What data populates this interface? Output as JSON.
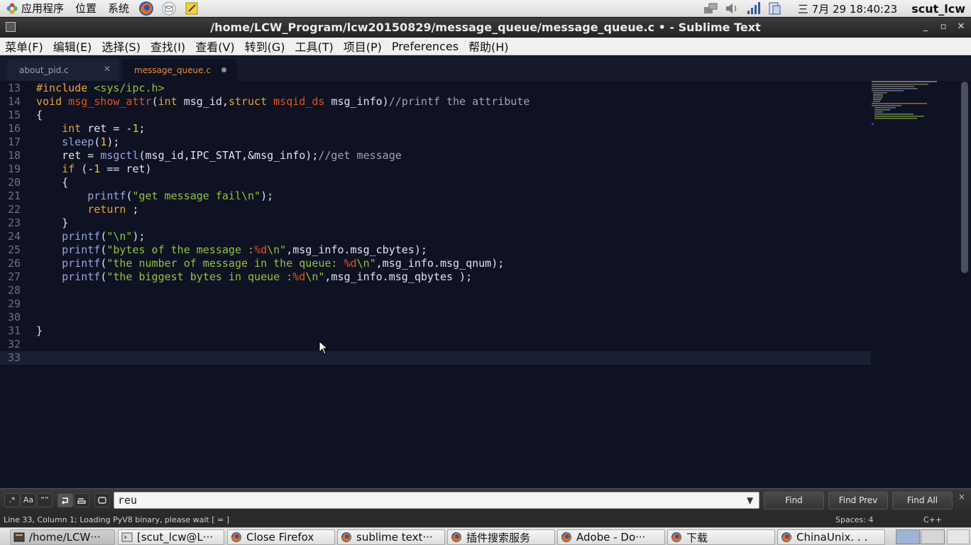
{
  "top_panel": {
    "menus": [
      "应用程序",
      "位置",
      "系统"
    ],
    "clock": "三 7月 29 18:40:23",
    "user": "scut_lcw"
  },
  "window": {
    "title": "/home/LCW_Program/lcw20150829/message_queue/message_queue.c • - Sublime Text"
  },
  "menubar": [
    "菜单(F)",
    "编辑(E)",
    "选择(S)",
    "查找(I)",
    "查看(V)",
    "转到(G)",
    "工具(T)",
    "项目(P)",
    "Preferences",
    "帮助(H)"
  ],
  "tabs": [
    {
      "label": "about_pid.c",
      "state": "saved"
    },
    {
      "label": "message_queue.c",
      "state": "modified"
    }
  ],
  "editor": {
    "current_line": 33,
    "lines": [
      {
        "n": "13",
        "text": "#include <sys/ipc.h>"
      },
      {
        "n": "14",
        "text": "void msg_show_attr(int msg_id,struct msqid_ds msg_info)//printf the attribute"
      },
      {
        "n": "15",
        "text": "{"
      },
      {
        "n": "16",
        "text": "    int ret = -1;"
      },
      {
        "n": "17",
        "text": "    sleep(1);"
      },
      {
        "n": "18",
        "text": "    ret = msgctl(msg_id,IPC_STAT,&msg_info);//get message"
      },
      {
        "n": "19",
        "text": "    if (-1 == ret)"
      },
      {
        "n": "20",
        "text": "    {"
      },
      {
        "n": "21",
        "text": "        printf(\"get message fail\\n\");"
      },
      {
        "n": "22",
        "text": "        return ;"
      },
      {
        "n": "23",
        "text": "    }"
      },
      {
        "n": "24",
        "text": "    printf(\"\\n\");"
      },
      {
        "n": "25",
        "text": "    printf(\"bytes of the message :%d\\n\",msg_info.msg_cbytes);"
      },
      {
        "n": "26",
        "text": "    printf(\"the number of message in the queue: %d\\n\",msg_info.msg_qnum);"
      },
      {
        "n": "27",
        "text": "    printf(\"the biggest bytes in queue :%d\\n\",msg_info.msg_qbytes );"
      },
      {
        "n": "28",
        "text": ""
      },
      {
        "n": "29",
        "text": ""
      },
      {
        "n": "30",
        "text": ""
      },
      {
        "n": "31",
        "text": "}"
      },
      {
        "n": "32",
        "text": ""
      },
      {
        "n": "33",
        "text": ""
      }
    ]
  },
  "find_panel": {
    "options": [
      ".*",
      "Aa",
      "“”"
    ],
    "query": "reu",
    "buttons": {
      "find": "Find",
      "find_prev": "Find Prev",
      "find_all": "Find All"
    },
    "close": "×"
  },
  "statusbar": {
    "text": "Line 33, Column 1; Loading PyV8 binary, please wait [    =    ]",
    "spaces": "Spaces: 4",
    "syntax": "C++"
  },
  "taskbar": [
    {
      "label": "/home/LCW···",
      "icon": "sublime-icon",
      "active": true
    },
    {
      "label": "[scut_lcw@L···",
      "icon": "terminal-icon",
      "active": false
    },
    {
      "label": "Close Firefox",
      "icon": "firefox-icon",
      "active": false
    },
    {
      "label": "sublime text···",
      "icon": "firefox-icon",
      "active": false
    },
    {
      "label": "插件搜索服务",
      "icon": "firefox-icon",
      "active": false
    },
    {
      "label": "Adobe - Do···",
      "icon": "firefox-icon",
      "active": false
    },
    {
      "label": "下载",
      "icon": "firefox-icon",
      "active": false
    },
    {
      "label": "ChinaUnix. . .",
      "icon": "firefox-icon",
      "active": false
    }
  ],
  "colors": {
    "editor_bg": "#0f1222",
    "keyword": "#e9a332",
    "function": "#e3531c",
    "string": "#8ec43d",
    "comment": "#9da3b8",
    "tab_active_text": "#e49040"
  }
}
